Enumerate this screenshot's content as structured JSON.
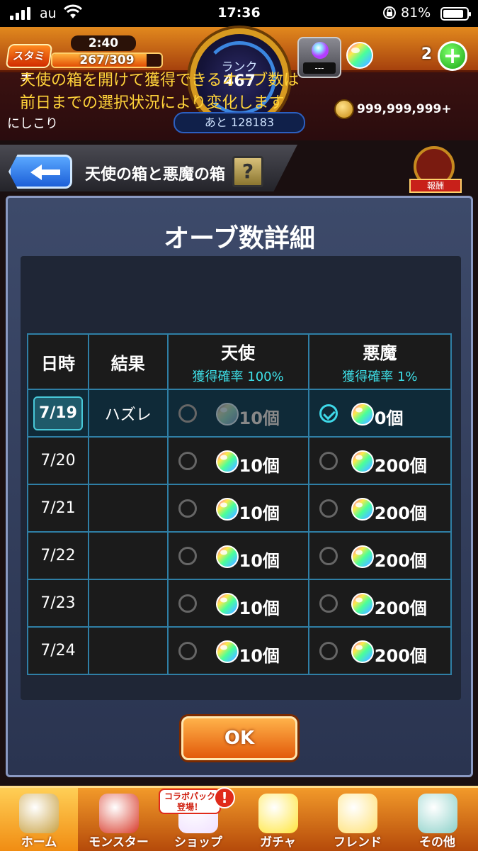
{
  "status_bar": {
    "carrier": "au",
    "time": "17:36",
    "battery_percent": "81%"
  },
  "header": {
    "stamina_label": "スタミナ",
    "stamina_timer": "2:40",
    "stamina_value": "267/309",
    "stamina_fraction": 0.864,
    "rank_label": "ランク",
    "rank_value": "467",
    "rank_next": "あと 128183",
    "gift_slot_text": "---",
    "orb_count": "2",
    "username": "にしこり",
    "coins": "999,999,999+"
  },
  "titlebar": {
    "title": "天使の箱と悪魔の箱",
    "help_label": "?",
    "side_label": "報酬"
  },
  "modal": {
    "title": "オーブ数詳細",
    "description_line1": "天使の箱を開けて獲得できるオーブ数は",
    "description_line2": "前日までの選択状況により変化します",
    "columns": {
      "date": "日時",
      "result": "結果",
      "angel": "天使",
      "angel_rate": "獲得確率 100%",
      "devil": "悪魔",
      "devil_rate": "獲得確率 1%"
    },
    "rows": [
      {
        "date": "7/19",
        "result": "ハズレ",
        "angel_count": "10個",
        "devil_count": "0個",
        "selected": "devil"
      },
      {
        "date": "7/20",
        "result": "",
        "angel_count": "10個",
        "devil_count": "200個",
        "selected": "none"
      },
      {
        "date": "7/21",
        "result": "",
        "angel_count": "10個",
        "devil_count": "200個",
        "selected": "none"
      },
      {
        "date": "7/22",
        "result": "",
        "angel_count": "10個",
        "devil_count": "200個",
        "selected": "none"
      },
      {
        "date": "7/23",
        "result": "",
        "angel_count": "10個",
        "devil_count": "200個",
        "selected": "none"
      },
      {
        "date": "7/24",
        "result": "",
        "angel_count": "10個",
        "devil_count": "200個",
        "selected": "none"
      }
    ],
    "ok_label": "OK"
  },
  "bottom_nav": {
    "items": [
      {
        "label": "ホーム",
        "icon": "home-icon",
        "active": true
      },
      {
        "label": "モンスター",
        "icon": "monster-icon",
        "active": false
      },
      {
        "label": "ショップ",
        "icon": "shop-icon",
        "active": false
      },
      {
        "label": "ガチャ",
        "icon": "gacha-icon",
        "active": false
      },
      {
        "label": "フレンド",
        "icon": "friend-icon",
        "active": false
      },
      {
        "label": "その他",
        "icon": "other-icon",
        "active": false
      }
    ],
    "collab_badge": "コラボパック 登場！",
    "collab_alert": "!"
  },
  "colors": {
    "accent_orange": "#e25a0a",
    "table_border": "#2f7fa6",
    "rate_cyan": "#3ee0e8",
    "description_yellow": "#ffd33a"
  }
}
